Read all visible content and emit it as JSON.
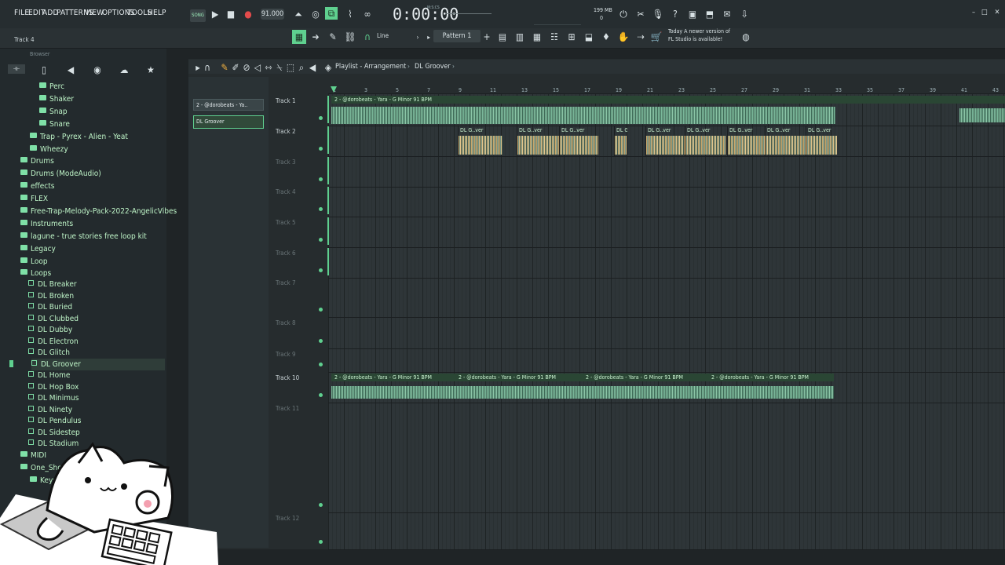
{
  "menu": [
    "FILE",
    "EDIT",
    "ADD",
    "PATTERNS",
    "VIEW",
    "OPTIONS",
    "TOOLS",
    "HELP"
  ],
  "transport": {
    "mode": "SONG",
    "tempo": "91.000",
    "time": "0:00:00",
    "time_sub": "M:S:CS",
    "cpu": "199 MB",
    "cpu_sub": "0"
  },
  "toolbar2": {
    "hint": "Track 4",
    "snap": "Line",
    "pattern": "Pattern 1",
    "news_line1": "Today  A newer version of",
    "news_line2": "FL Studio is available!"
  },
  "browser": {
    "title": "Browser",
    "items": [
      {
        "label": "Perc",
        "type": "folder",
        "indent": 3
      },
      {
        "label": "Shaker",
        "type": "folder",
        "indent": 3
      },
      {
        "label": "Snap",
        "type": "folder",
        "indent": 3
      },
      {
        "label": "Snare",
        "type": "folder",
        "indent": 3
      },
      {
        "label": "Trap - Pyrex - Alien - Yeat",
        "type": "folder",
        "indent": 2
      },
      {
        "label": "Wheezy",
        "type": "folder",
        "indent": 2
      },
      {
        "label": "Drums",
        "type": "folder",
        "indent": 1
      },
      {
        "label": "Drums (ModeAudio)",
        "type": "folder",
        "indent": 1
      },
      {
        "label": "effects",
        "type": "folder",
        "indent": 1
      },
      {
        "label": "FLEX",
        "type": "folder",
        "indent": 1
      },
      {
        "label": "Free-Trap-Melody-Pack-2022-AngelicVibes",
        "type": "folder",
        "indent": 1
      },
      {
        "label": "Instruments",
        "type": "folder",
        "indent": 1
      },
      {
        "label": "lagune - true stories free loop kit",
        "type": "folder",
        "indent": 1
      },
      {
        "label": "Legacy",
        "type": "folder",
        "indent": 1
      },
      {
        "label": "Loop",
        "type": "folder",
        "indent": 1
      },
      {
        "label": "Loops",
        "type": "folder",
        "indent": 1
      }
    ],
    "loops": [
      "DL Breaker",
      "DL Broken",
      "DL Buried",
      "DL Clubbed",
      "DL Dubby",
      "DL Electron",
      "DL Glitch",
      "DL Groover",
      "DL Home",
      "DL Hop Box",
      "DL Minimus",
      "DL Ninety",
      "DL Pendulus",
      "DL Sidestep",
      "DL Stadium"
    ],
    "after": [
      {
        "label": "MIDI",
        "indent": 1
      },
      {
        "label": "One_Shot",
        "indent": 1
      },
      {
        "label": "Keys",
        "indent": 2
      }
    ]
  },
  "playlist": {
    "breadcrumb": [
      "Playlist - Arrangement",
      "DL Groover"
    ],
    "picker": [
      "2 - @dorobeats - Ya..",
      "DL Groover"
    ],
    "tracks": [
      "Track 1",
      "Track 2",
      "Track 3",
      "Track 4",
      "Track 5",
      "Track 6",
      "Track 7",
      "Track 8",
      "Track 9",
      "Track 10",
      "Track 11",
      "Track 12"
    ],
    "ruler": [
      "1",
      "3",
      "5",
      "7",
      "9",
      "11",
      "13",
      "15",
      "17",
      "19",
      "21",
      "23",
      "25",
      "27",
      "29",
      "31",
      "33",
      "35",
      "37",
      "39",
      "41",
      "43"
    ],
    "clips": {
      "track1": "2 - @dorobeats - Yara - G Minor 91 BPM",
      "track2": "DL G..ver",
      "track10": "2 - @dorobeats - Yara - G Minor 91 BPM"
    }
  },
  "colors": {
    "accent": "#7fe0a7",
    "bg": "#262c2e"
  }
}
